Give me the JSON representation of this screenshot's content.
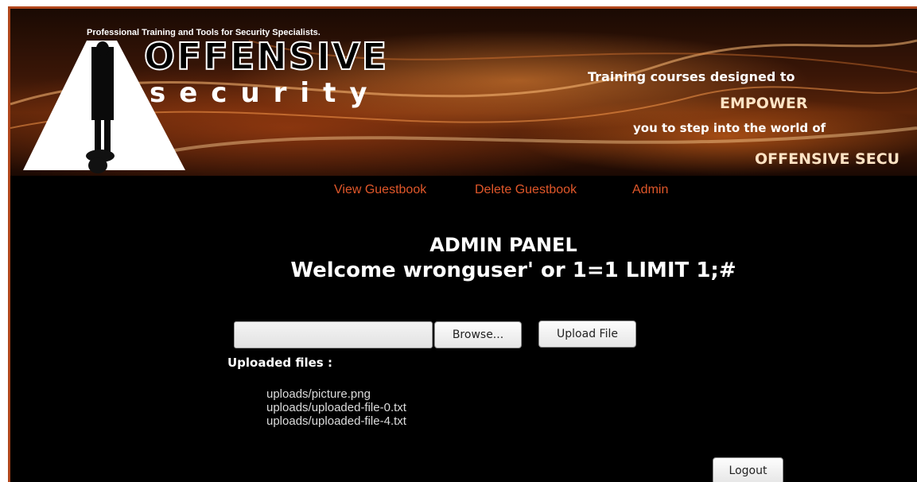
{
  "header": {
    "tagline": "Professional Training and Tools for Security Specialists.",
    "logo_line1": "OFFENSIVE",
    "logo_line2": "security",
    "promo": [
      "Training courses designed to",
      "EMPOWER",
      "you to step into the world of",
      "OFFENSIVE SECU"
    ]
  },
  "nav": {
    "items": [
      {
        "label": "View Guestbook"
      },
      {
        "label": "Delete Guestbook"
      },
      {
        "label": "Admin"
      }
    ]
  },
  "main": {
    "title": "ADMIN PANEL",
    "welcome": "Welcome wronguser' or 1=1 LIMIT 1;#",
    "file_input": {
      "value": "",
      "browse_label": "Browse..."
    },
    "upload_label": "Upload File",
    "uploaded_heading": "Uploaded files :",
    "files": [
      "uploads/picture.png",
      "uploads/uploaded-file-0.txt",
      "uploads/uploaded-file-4.txt"
    ],
    "logout_label": "Logout"
  },
  "colors": {
    "nav_link": "#e0572a",
    "page_background": "#000000",
    "border": "#b0461c"
  }
}
